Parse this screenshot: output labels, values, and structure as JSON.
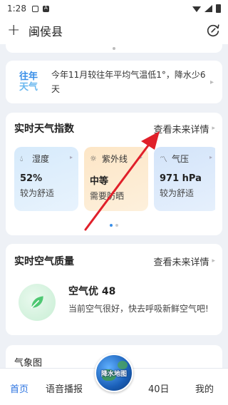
{
  "status": {
    "time": "1:28",
    "notif_badge": "A"
  },
  "header": {
    "city": "闽侯县"
  },
  "history": {
    "logo_line1": "往年",
    "logo_line2": "天气",
    "text": "今年11月较往年平均气温低1°，降水少6天"
  },
  "index": {
    "title": "实时天气指数",
    "more": "查看未来详情",
    "tiles": [
      {
        "name": "湿度",
        "value": "52%",
        "desc": "较为舒适",
        "icon": "water-drop-icon"
      },
      {
        "name": "紫外线",
        "value": "中等",
        "desc": "需要防晒",
        "icon": "sun-icon"
      },
      {
        "name": "气压",
        "value": "971 hPa",
        "desc": "较为舒适",
        "icon": "pressure-icon"
      }
    ]
  },
  "air": {
    "title": "实时空气质量",
    "more": "查看未来详情",
    "quality": "空气优 48",
    "desc": "当前空气很好，快去呼吸新鲜空气吧!"
  },
  "chart_card": {
    "title": "气象图"
  },
  "tabs": {
    "home": "首页",
    "voice": "语音播报",
    "center": "降水地图",
    "forty": "40日",
    "mine": "我的"
  },
  "colors": {
    "accent": "#2b73e0",
    "annotation_arrow": "#e0202a"
  }
}
